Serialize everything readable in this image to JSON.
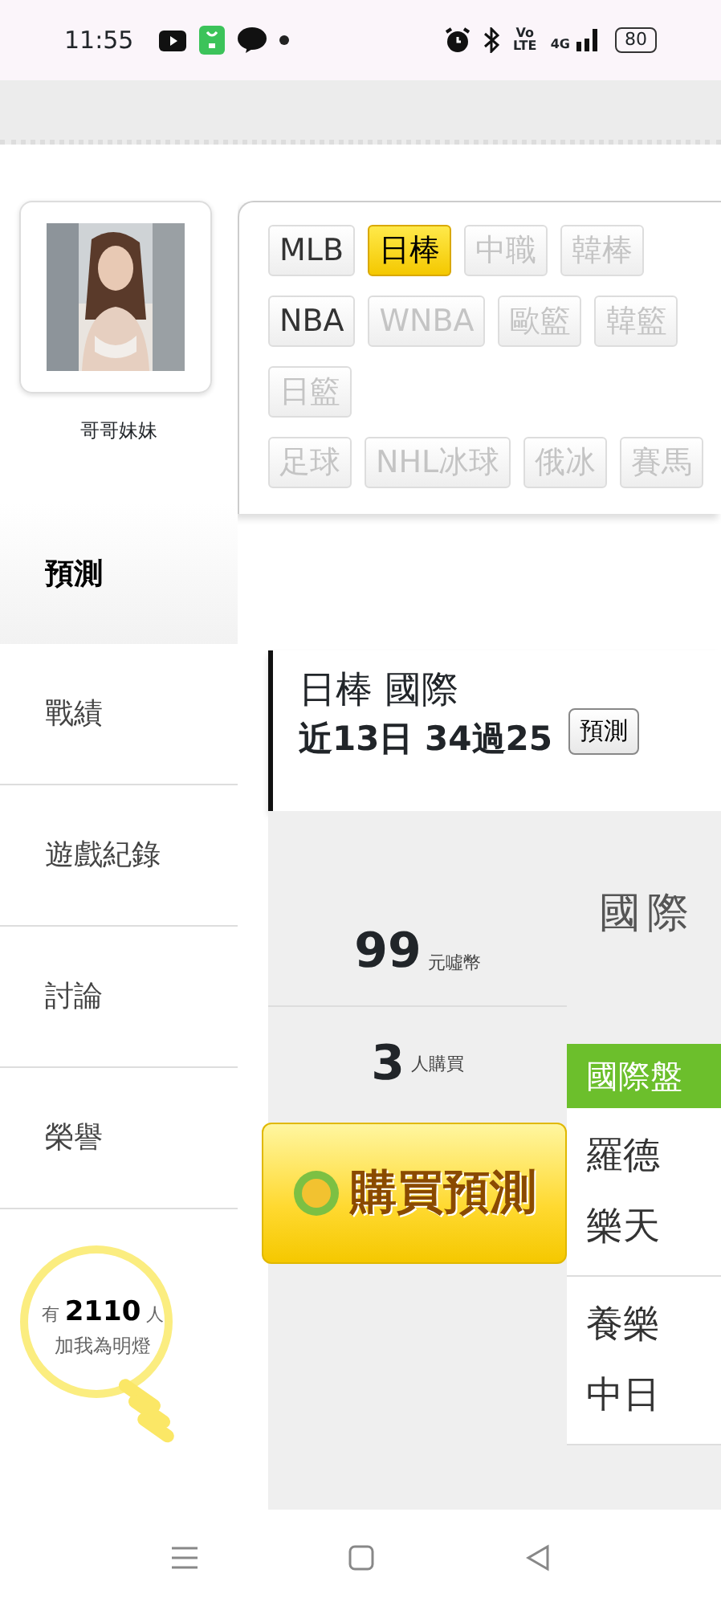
{
  "status_bar": {
    "time": "11:55",
    "volte": "Vo LTE",
    "network": "4G",
    "battery": "80"
  },
  "profile": {
    "kind": "picture",
    "name": "哥哥妹妹"
  },
  "sport_tags": [
    [
      {
        "label": "MLB",
        "selected": false,
        "disabled": false
      },
      {
        "label": "日棒",
        "selected": true,
        "disabled": false
      },
      {
        "label": "中職",
        "selected": false,
        "disabled": true
      },
      {
        "label": "韓棒",
        "selected": false,
        "disabled": true
      }
    ],
    [
      {
        "label": "NBA",
        "selected": false,
        "disabled": false
      },
      {
        "label": "WNBA",
        "selected": false,
        "disabled": true
      },
      {
        "label": "歐籃",
        "selected": false,
        "disabled": true
      },
      {
        "label": "韓籃",
        "selected": false,
        "disabled": true
      }
    ],
    [
      {
        "label": "日籃",
        "selected": false,
        "disabled": true
      }
    ],
    [
      {
        "label": "足球",
        "selected": false,
        "disabled": true
      },
      {
        "label": "NHL冰球",
        "selected": false,
        "disabled": true
      },
      {
        "label": "俄冰",
        "selected": false,
        "disabled": true
      },
      {
        "label": "賽馬",
        "selected": false,
        "disabled": true
      }
    ]
  ],
  "sidebar": {
    "items": [
      {
        "label": "預測",
        "selected": true
      },
      {
        "label": "戰績",
        "selected": false
      },
      {
        "label": "遊戲紀錄",
        "selected": false
      },
      {
        "label": "討論",
        "selected": false
      },
      {
        "label": "榮譽",
        "selected": false
      }
    ],
    "fans": {
      "text": "有 **2110** 人",
      "caption": "加我為明燈"
    }
  },
  "prediction": {
    "title": "日棒 國際",
    "record": "近13日 34過25",
    "button": "預測",
    "price": "99",
    "price_unit": "元噓幣",
    "buyers": "3",
    "buyers_unit": "人購買",
    "buy_button": "購買預測",
    "market_heading": "國際",
    "market_tab": "國際盤",
    "games": [
      {
        "home": "羅德",
        "away": "樂天"
      },
      {
        "home": "養樂",
        "away": "中日"
      }
    ]
  }
}
